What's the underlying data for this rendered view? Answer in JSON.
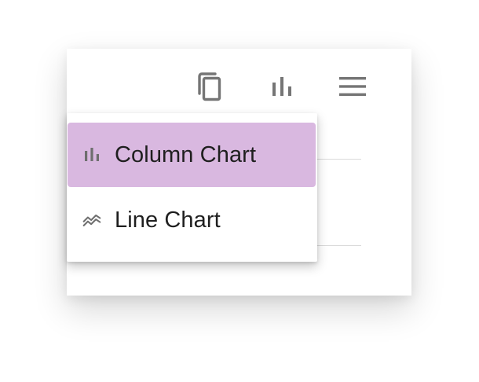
{
  "toolbar": {
    "icons": [
      "copy-icon",
      "bar-chart-icon",
      "menu-icon"
    ],
    "icon_color": "#757575"
  },
  "chart_menu": {
    "selected_index": 0,
    "highlight_color": "#d9b8e0",
    "items": [
      {
        "label": "Column Chart",
        "icon": "column-chart-icon"
      },
      {
        "label": "Line Chart",
        "icon": "line-chart-icon"
      }
    ]
  }
}
